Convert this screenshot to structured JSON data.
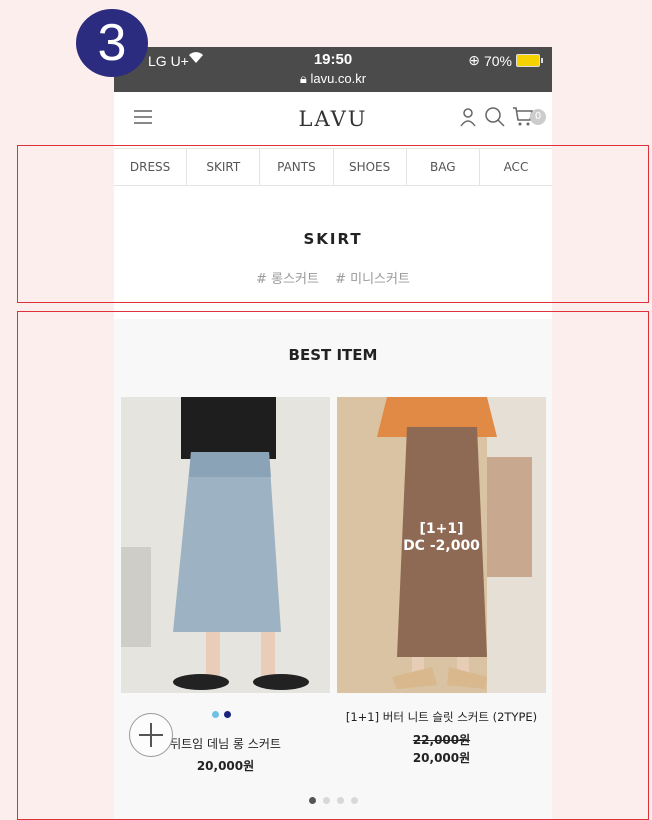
{
  "step_badge": "3",
  "status_bar": {
    "carrier": "LG U+",
    "time": "19:50",
    "url": "lavu.co.kr",
    "battery": "70%"
  },
  "header": {
    "logo": "LAVU",
    "cart_count": "0"
  },
  "categories": [
    "DRESS",
    "SKIRT",
    "PANTS",
    "SHOES",
    "BAG",
    "ACC"
  ],
  "page_title": "SKIRT",
  "tags": [
    "# 롱스커트",
    "# 미니스커트"
  ],
  "best": {
    "title": "BEST ITEM",
    "products": [
      {
        "name": "뒤트임 데님 롱 스커트",
        "price": "20,000원",
        "swatches": [
          "#6ec1e4",
          "#1a237e"
        ]
      },
      {
        "name": "[1+1] 버터 니트 슬릿 스커트 (2TYPE)",
        "original_price": "22,000원",
        "price": "20,000원",
        "promo_line1": "[1+1]",
        "promo_line2": "DC -2,000"
      }
    ],
    "pagination_total": 4,
    "pagination_active": 1
  },
  "colors": {
    "highlight": "#e0303a",
    "badge": "#2b2b80",
    "page_background": "#fdeeee"
  }
}
